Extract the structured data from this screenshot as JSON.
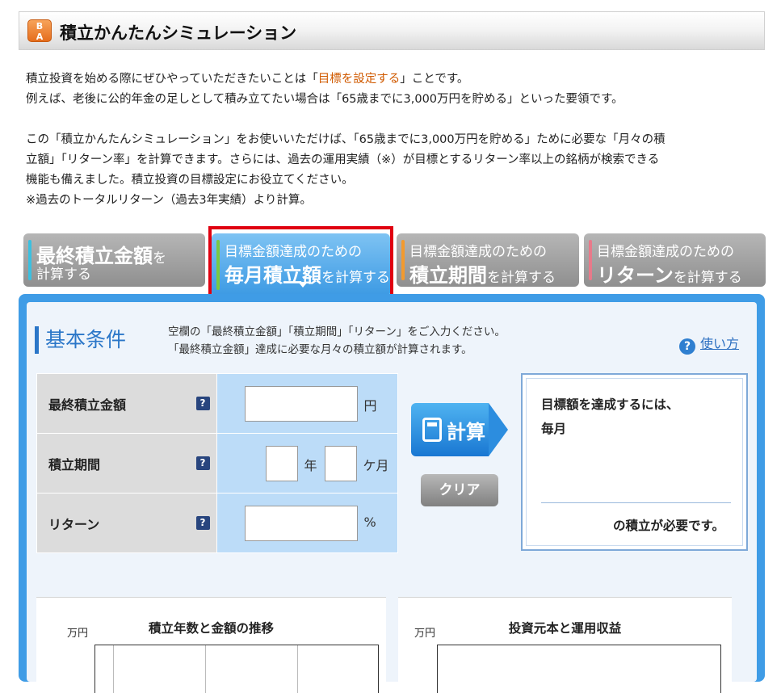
{
  "header": {
    "icon_text": "Ｂ\nＡ",
    "title": "積立かんたんシミュレーション"
  },
  "intro": {
    "line1_a": "積立投資を始める際にぜひやっていただきたいことは「",
    "line1_hl": "目標を設定する",
    "line1_b": "」ことです。",
    "line2": "例えば、老後に公的年金の足しとして積み立てたい場合は「65歳までに3,000万円を貯める」といった要領です。",
    "para2_l1": "この「積立かんたんシミュレーション」をお使いいただけば、「65歳までに3,000万円を貯める」ために必要な「月々の積",
    "para2_l2": "立額」「リターン率」を計算できます。さらには、過去の運用実績（※）が目標とするリターン率以上の銘柄が検索できる",
    "para2_l3": "機能も備えました。積立投資の目標設定にお役立てください。",
    "note": "※過去のトータルリターン（過去3年実績）より計算。"
  },
  "tabs": [
    {
      "big": "最終積立金額",
      "small_a": "を",
      "line2": "計算する",
      "bar_color": "#3bc0e0"
    },
    {
      "top": "目標金額達成のための",
      "big": "毎月積立額",
      "small": "を計算する",
      "bar_color": "#7ac943",
      "active": true
    },
    {
      "top": "目標金額達成のための",
      "big": "積立期間",
      "small": "を計算する",
      "bar_color": "#f39a2e"
    },
    {
      "top": "目標金額達成のための",
      "big": "リターン",
      "small": "を計算する",
      "bar_color": "#e87a8a"
    }
  ],
  "section": {
    "title": "基本条件",
    "desc1": "空欄の「最終積立金額」「積立期間」「リターン」をご入力ください。",
    "desc2": "「最終積立金額」達成に必要な月々の積立額が計算されます。",
    "help_icon": "?",
    "help_label": "使い方"
  },
  "form": {
    "rows": [
      {
        "label": "最終積立金額",
        "q": "?"
      },
      {
        "label": "積立期間",
        "q": "?"
      },
      {
        "label": "リターン",
        "q": "?"
      }
    ],
    "amount_value": "",
    "amount_unit": "円",
    "years_value": "",
    "years_unit": "年",
    "months_value": "",
    "months_unit": "ケ月",
    "return_value": "",
    "return_unit": "%"
  },
  "buttons": {
    "calc_label": "計算",
    "clear_label": "クリア"
  },
  "result": {
    "line1": "目標額を達成するには、",
    "line2": "毎月",
    "value": "",
    "line3": "の積立が必要です。"
  },
  "charts": [
    {
      "title": "積立年数と金額の推移",
      "unit": "万円"
    },
    {
      "title": "投資元本と運用収益",
      "unit": "万円"
    }
  ],
  "icons": [
    "calculator-icon",
    "help-icon",
    "question-icon",
    "caret-down-icon",
    "header-app-icon"
  ]
}
